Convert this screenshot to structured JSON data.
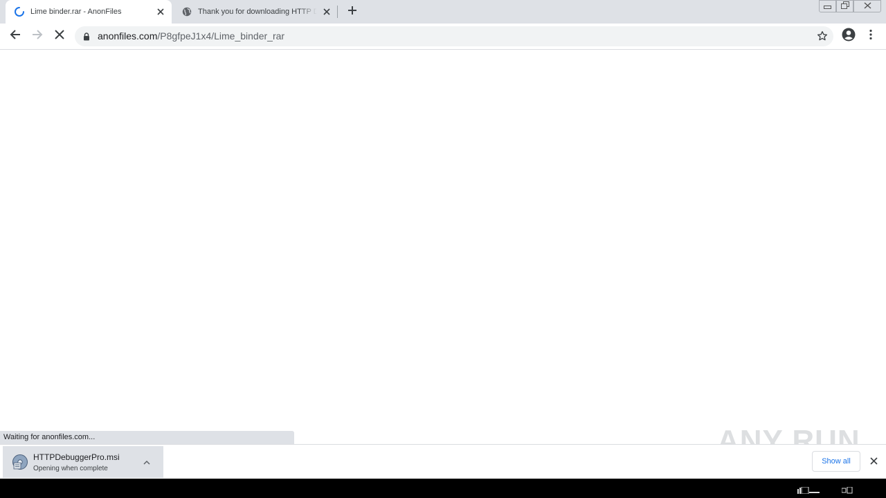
{
  "tabs": [
    {
      "title": "Lime binder.rar - AnonFiles",
      "active": true,
      "loading": true
    },
    {
      "title": "Thank you for downloading HTTP Debugger",
      "active": false
    }
  ],
  "address": {
    "domain": "anonfiles.com",
    "path": "/P8gfpeJ1x4/Lime_binder_rar"
  },
  "status_bar": {
    "text": "Waiting for anonfiles.com..."
  },
  "download_shelf": {
    "item": {
      "filename": "HTTPDebuggerPro.msi",
      "status": "Opening when complete"
    },
    "show_all_label": "Show all"
  },
  "watermark": {
    "text": "ANY RUN"
  },
  "colors": {
    "tabbar_bg": "#dee1e6",
    "omnibox_bg": "#f1f3f4",
    "accent_blue": "#1a73e8",
    "icon_gray": "#5f6368"
  },
  "icons": {
    "loading_spinner": "spinner-icon",
    "globe": "globe-icon",
    "back": "back-arrow-icon",
    "forward": "forward-arrow-icon",
    "stop": "stop-x-icon",
    "lock": "lock-icon",
    "star": "star-icon",
    "profile": "account-icon",
    "menu": "kebab-menu-icon"
  }
}
